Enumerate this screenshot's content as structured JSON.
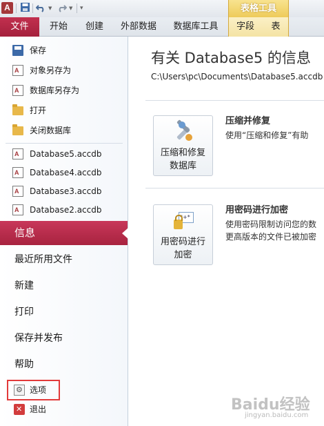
{
  "qat": {
    "app_icon": "A",
    "save_icon": "save-icon",
    "undo_icon": "undo-icon",
    "redo_icon": "redo-icon"
  },
  "ribbon": {
    "context_header": "表格工具",
    "tabs": [
      "文件",
      "开始",
      "创建",
      "外部数据",
      "数据库工具",
      "字段",
      "表"
    ]
  },
  "backstage": {
    "menu_items": [
      {
        "label": "保存",
        "icon": "save-icon"
      },
      {
        "label": "对象另存为",
        "icon": "save-as-icon"
      },
      {
        "label": "数据库另存为",
        "icon": "database-save-as-icon"
      },
      {
        "label": "打开",
        "icon": "open-folder-icon"
      },
      {
        "label": "关闭数据库",
        "icon": "close-database-icon"
      }
    ],
    "recent_files": [
      "Database5.accdb",
      "Database4.accdb",
      "Database3.accdb",
      "Database2.accdb"
    ],
    "info_label": "信息",
    "sections": [
      "最近所用文件",
      "新建",
      "打印",
      "保存并发布",
      "帮助"
    ],
    "options_label": "选项",
    "exit_label": "退出"
  },
  "main": {
    "title": "有关 Database5 的信息",
    "path": "C:\\Users\\pc\\Documents\\Database5.accdb",
    "compact": {
      "button_label": "压缩和修复\n数据库",
      "heading": "压缩并修复",
      "description": "使用“压缩和修复”有助"
    },
    "encrypt": {
      "button_label": "用密码进行\n加密",
      "heading": "用密码进行加密",
      "description_1": "使用密码限制访问您的数",
      "description_2": "更高版本的文件已被加密"
    }
  },
  "watermark": {
    "text": "Baidu经验",
    "sub": "jingyan.baidu.com"
  }
}
